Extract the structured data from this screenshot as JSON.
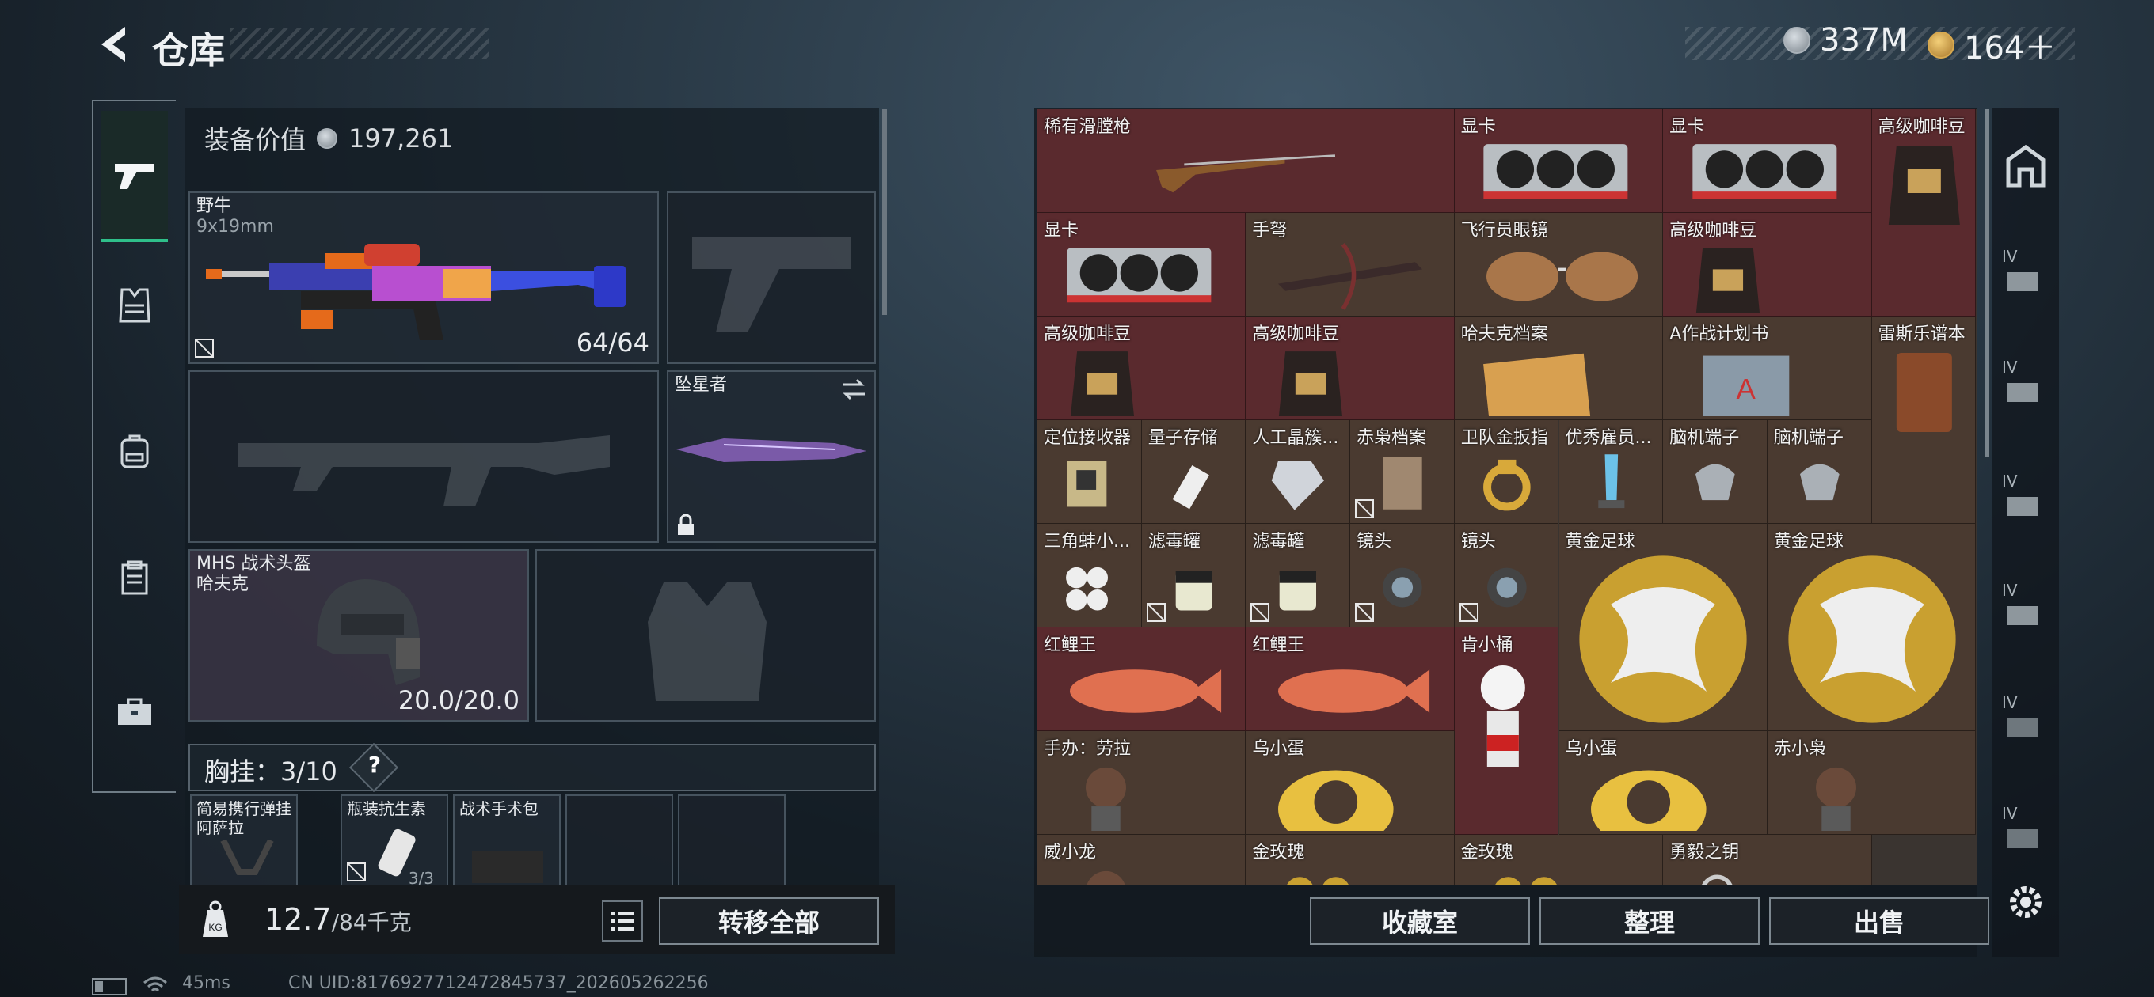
{
  "header": {
    "title": "仓库",
    "currency": {
      "silver": "337M",
      "gold": "164＋"
    }
  },
  "left": {
    "equip_value_label": "装备价值",
    "equip_value": "197,261",
    "primary": {
      "name": "野牛",
      "ammo": "9x19mm",
      "count": "64/64"
    },
    "melee": {
      "name": "坠星者"
    },
    "helmet": {
      "line1": "MHS 战术头盔",
      "line2": "哈夫克",
      "durability": "20.0/20.0"
    },
    "chest": {
      "label": "胸挂：",
      "count": "3/10",
      "help": "?"
    },
    "chest_items": [
      {
        "l1": "简易携行弹挂",
        "l2": "阿萨拉"
      },
      {
        "l1": "瓶装抗生素",
        "l2": "3/3"
      },
      {
        "l1": "战术手术包",
        "l2": ""
      }
    ],
    "weight": "12.7",
    "weight_max": "/84千克",
    "kg": "KG",
    "transfer_all": "转移全部"
  },
  "stash": {
    "items": [
      {
        "name": "稀有滑膛枪",
        "bg": "red",
        "icon": "musket-icon"
      },
      {
        "name": "显卡",
        "bg": "red",
        "icon": "gpu-icon"
      },
      {
        "name": "显卡",
        "bg": "red",
        "icon": "gpu-icon"
      },
      {
        "name": "高级咖啡豆",
        "bg": "red",
        "icon": "coffee-bag-icon"
      },
      {
        "name": "显卡",
        "bg": "red",
        "icon": "gpu-icon"
      },
      {
        "name": "手弩",
        "bg": "brn",
        "icon": "crossbow-icon"
      },
      {
        "name": "飞行员眼镜",
        "bg": "brn",
        "icon": "aviator-glasses-icon"
      },
      {
        "name": "高级咖啡豆",
        "bg": "red",
        "icon": "coffee-bag-icon"
      },
      {
        "name": "高级咖啡豆",
        "bg": "red",
        "icon": "coffee-bag-icon"
      },
      {
        "name": "高级咖啡豆",
        "bg": "red",
        "icon": "coffee-bag-icon"
      },
      {
        "name": "哈夫克档案",
        "bg": "brn",
        "icon": "folder-icon"
      },
      {
        "name": "A作战计划书",
        "bg": "brn",
        "icon": "plan-book-icon"
      },
      {
        "name": "雷斯乐谱本",
        "bg": "brn",
        "icon": "notebook-icon"
      },
      {
        "name": "定位接收器",
        "bg": "brn",
        "icon": "receiver-icon"
      },
      {
        "name": "量子存储",
        "bg": "brn",
        "icon": "usb-icon"
      },
      {
        "name": "人工晶簇...",
        "bg": "brn",
        "icon": "crystal-icon"
      },
      {
        "name": "赤枭档案",
        "bg": "brn",
        "icon": "file-icon"
      },
      {
        "name": "卫队金扳指",
        "bg": "brn",
        "icon": "ring-icon"
      },
      {
        "name": "优秀雇员...",
        "bg": "brn",
        "icon": "trophy-icon"
      },
      {
        "name": "脑机端子",
        "bg": "brn",
        "icon": "terminal-icon"
      },
      {
        "name": "脑机端子",
        "bg": "brn",
        "icon": "terminal-icon"
      },
      {
        "name": "三角蚌小...",
        "bg": "brn",
        "icon": "pearls-icon"
      },
      {
        "name": "滤毒罐",
        "bg": "brn",
        "icon": "filter-icon"
      },
      {
        "name": "滤毒罐",
        "bg": "brn",
        "icon": "filter-icon"
      },
      {
        "name": "镜头",
        "bg": "brn",
        "icon": "lens-icon"
      },
      {
        "name": "镜头",
        "bg": "brn",
        "icon": "lens-icon"
      },
      {
        "name": "黄金足球",
        "bg": "brn",
        "icon": "gold-football-icon"
      },
      {
        "name": "黄金足球",
        "bg": "brn",
        "icon": "gold-football-icon"
      },
      {
        "name": "红鲤王",
        "bg": "red",
        "icon": "carp-icon"
      },
      {
        "name": "红鲤王",
        "bg": "red",
        "icon": "carp-icon"
      },
      {
        "name": "肯小桶",
        "bg": "red",
        "icon": "kfc-figure-icon"
      },
      {
        "name": "手办：劳拉",
        "bg": "brn",
        "icon": "figure-icon"
      },
      {
        "name": "乌小蛋",
        "bg": "brn",
        "icon": "egg-figure-icon"
      },
      {
        "name": "乌小蛋",
        "bg": "brn",
        "icon": "egg-figure-icon"
      },
      {
        "name": "赤小枭",
        "bg": "brn",
        "icon": "figure-icon"
      },
      {
        "name": "威小龙",
        "bg": "brn",
        "icon": "figure-icon"
      },
      {
        "name": "金玫瑰",
        "bg": "brn",
        "icon": "rose-icon"
      },
      {
        "name": "金玫瑰",
        "bg": "brn",
        "icon": "rose-icon"
      },
      {
        "name": "勇毅之钥",
        "bg": "brn",
        "icon": "key-icon"
      }
    ],
    "buttons": {
      "collection": "收藏室",
      "sort": "整理",
      "sell": "出售"
    }
  },
  "sidebar_right": {
    "badge": "IV"
  },
  "status": {
    "ping": "45ms",
    "uid": "CN UID:8176927712472845737_202605262256"
  }
}
